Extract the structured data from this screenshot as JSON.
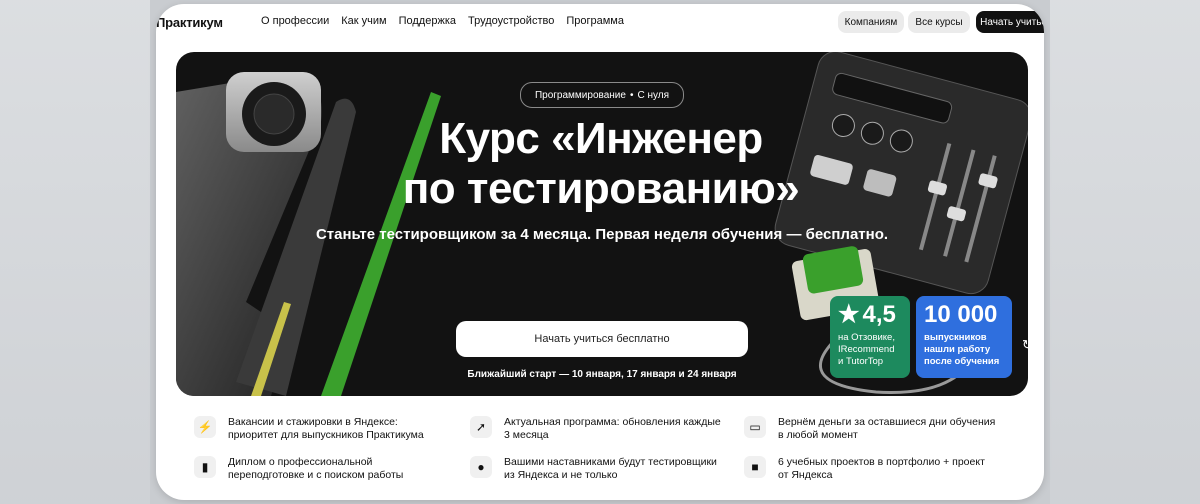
{
  "nav": {
    "logo": "Практикум",
    "links": [
      "О профессии",
      "Как учим",
      "Поддержка",
      "Трудоустройство",
      "Программа"
    ],
    "btn_companies": "Компаниям",
    "btn_courses": "Все курсы",
    "btn_start": "Начать учиться"
  },
  "hero": {
    "tag_left": "Программирование",
    "tag_dot": "•",
    "tag_right": "С нуля",
    "title_line1": "Курс «Инженер",
    "title_line2": "по тестированию»",
    "subtitle": "Станьте тестировщиком за 4 месяца. Первая неделя обучения — бесплатно.",
    "cta": "Начать учиться бесплатно",
    "next_start": "Ближайший старт — 10 января, 17 января и 24 января"
  },
  "stats": {
    "rating_value": "4,5",
    "rating_caption_1": "на Отзовике,",
    "rating_caption_2": "IRecommend",
    "rating_caption_3": "и TutorTop",
    "graduates_value": "10 000",
    "graduates_caption_1": "выпускников",
    "graduates_caption_2": "нашли работу",
    "graduates_caption_3": "после обучения"
  },
  "features": [
    {
      "icon": "lightning-icon",
      "line1": "Вакансии и стажировки в Яндексе:",
      "line2": "приоритет для выпускников Практикума"
    },
    {
      "icon": "rocket-icon",
      "line1": "Актуальная программа: обновления каждые",
      "line2": "3 месяца"
    },
    {
      "icon": "card-icon",
      "line1": "Вернём деньги за оставшиеся дни обучения",
      "line2": "в любой момент"
    },
    {
      "icon": "diploma-icon",
      "line1": "Диплом о профессиональной",
      "line2": "переподготовке и с поиском работы"
    },
    {
      "icon": "person-icon",
      "line1": "Вашими наставниками будут тестировщики",
      "line2": "из Яндекса и не только"
    },
    {
      "icon": "video-icon",
      "line1": "6 учебных проектов в портфолио + проект",
      "line2": "от Яндекса"
    }
  ],
  "colors": {
    "accent_green": "#1d8a5e",
    "accent_blue": "#2f6fde",
    "hero_bg": "#121212"
  }
}
